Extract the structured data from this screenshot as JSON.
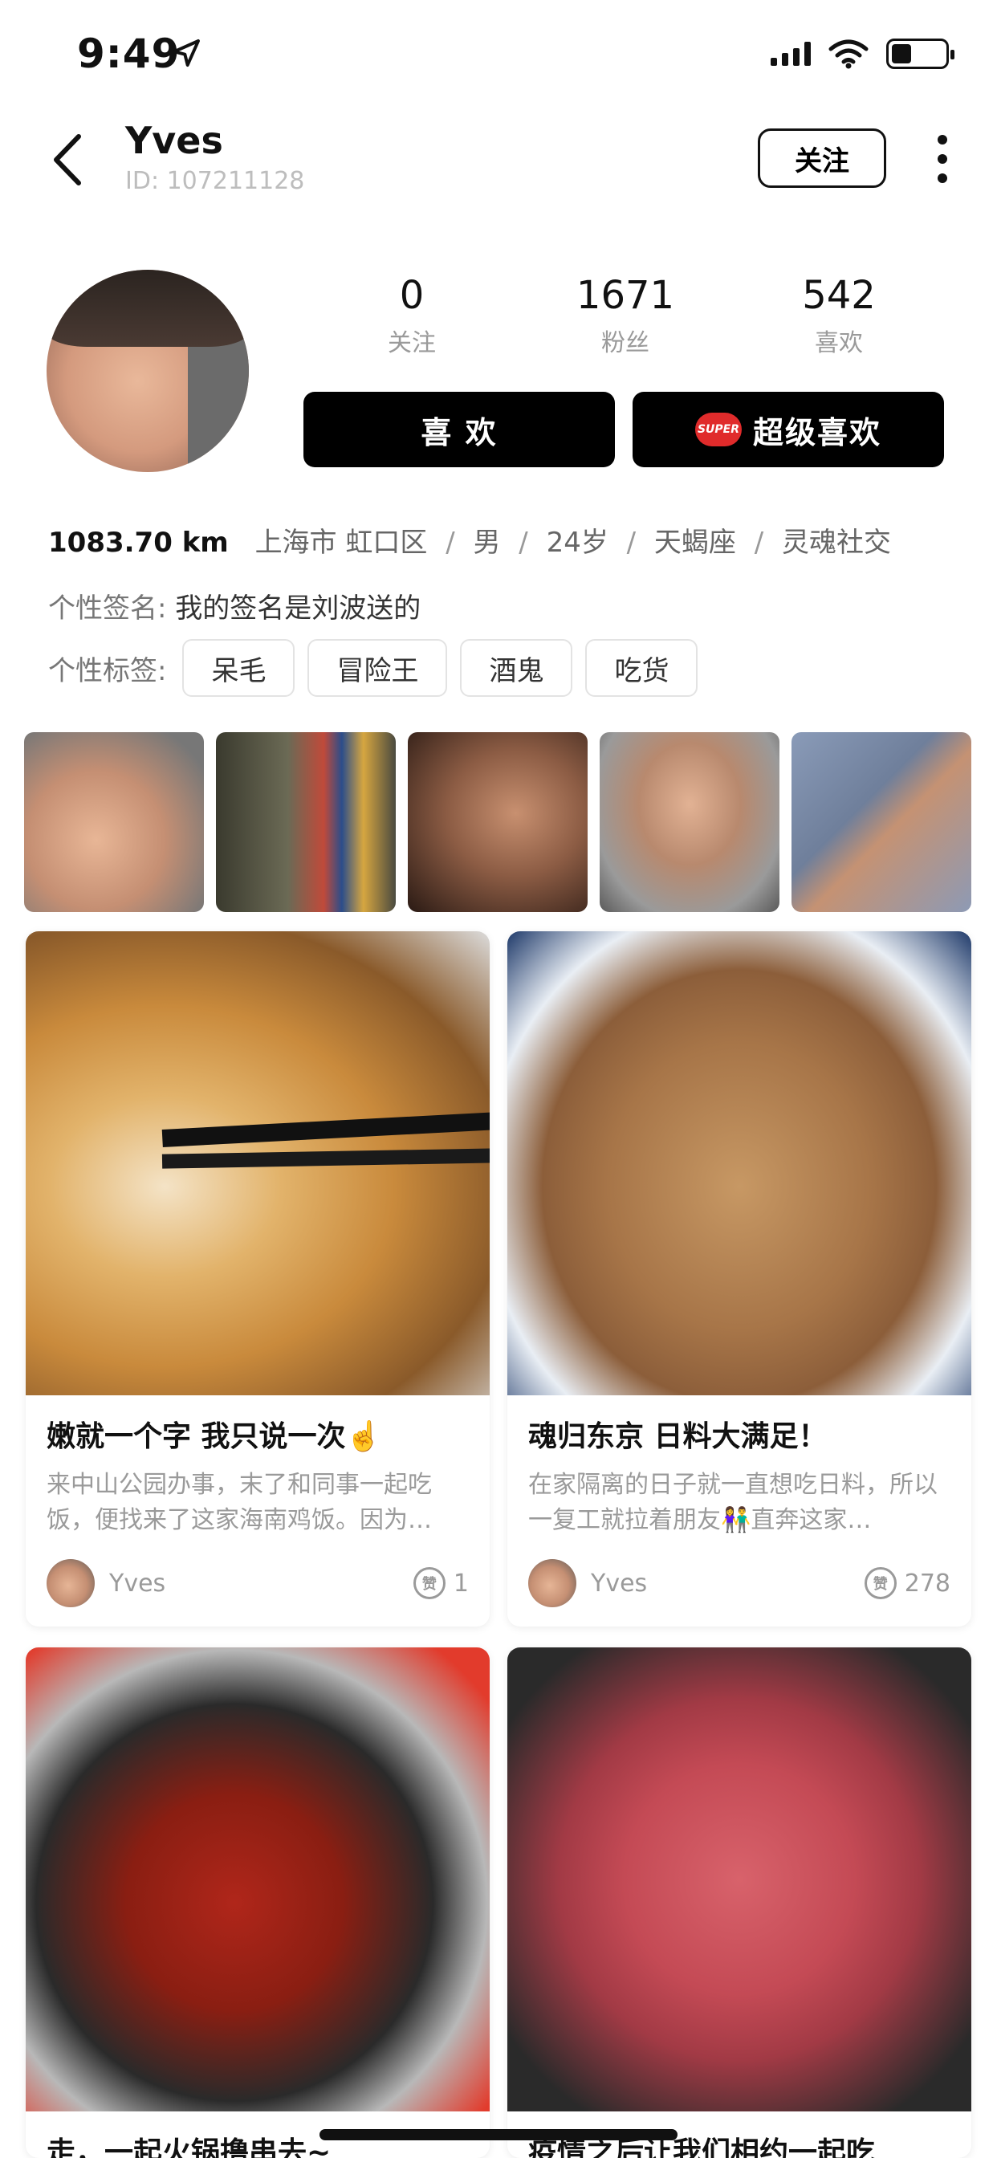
{
  "status_bar": {
    "time": "9:49"
  },
  "header": {
    "name": "Yves",
    "id_text": "ID: 107211128",
    "follow_label": "关注"
  },
  "profile": {
    "stats": [
      {
        "value": "0",
        "label": "关注"
      },
      {
        "value": "1671",
        "label": "粉丝"
      },
      {
        "value": "542",
        "label": "喜欢"
      }
    ],
    "like_button": "喜 欢",
    "super_like_button": "超级喜欢",
    "super_badge": "SUPER",
    "distance": "1083.70 km",
    "info": [
      "上海市 虹口区",
      "男",
      "24岁",
      "天蝎座",
      "灵魂社交"
    ],
    "signature_label": "个性签名:",
    "signature": "我的签名是刘波送的",
    "tags_label": "个性标签:",
    "tags": [
      "呆毛",
      "冒险王",
      "酒鬼",
      "吃货"
    ]
  },
  "feed": [
    {
      "title": "嫩就一个字 我只说一次☝️",
      "desc": "来中山公园办事，末了和同事一起吃饭，便找来了这家海南鸡饭。因为…",
      "author": "Yves",
      "likes": "1",
      "like_icon_text": "赞"
    },
    {
      "title": "魂归东京 日料大满足！",
      "desc": "在家隔离的日子就一直想吃日料，所以一复工就拉着朋友👫直奔这家…",
      "author": "Yves",
      "likes": "278",
      "like_icon_text": "赞"
    },
    {
      "title": "走，一起火锅撸串去~"
    },
    {
      "title": "疫情之后让我们相约一起吃"
    }
  ]
}
